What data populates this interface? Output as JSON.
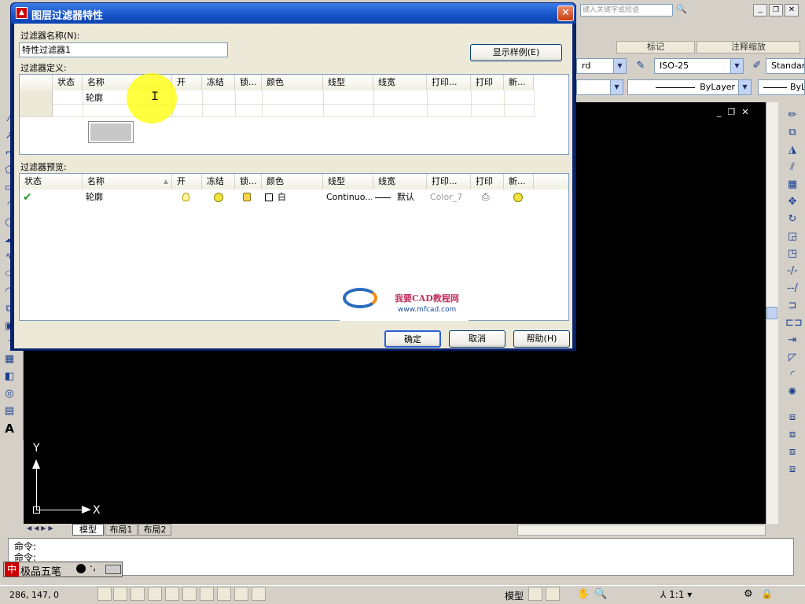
{
  "app": {
    "search_placeholder": "键入关键字或短语",
    "ribbon_tabs": [
      "标记",
      "注释缩放"
    ],
    "dimstyle_value": "ISO-25",
    "textstyle_value": "Standar",
    "leftcombo_value": "rd",
    "linetype_value": "ByLayer",
    "lineweight_value": "ByL",
    "layout_tabs": [
      "模型",
      "布局1",
      "布局2"
    ],
    "command_lines": [
      "命令:",
      "命令:"
    ],
    "ime_label": "极品五笔",
    "ime_char": "中",
    "coords": "286, 147, 0",
    "status_model_label": "模型",
    "annotation_scale": "1:1",
    "axis_x": "X",
    "axis_y": "Y"
  },
  "dialog": {
    "title": "图层过滤器特性",
    "filter_name_label": "过滤器名称(N):",
    "filter_name_value": "特性过滤器1",
    "show_example_button": "显示样例(E)",
    "definition_label": "过滤器定义:",
    "definition_columns": [
      "状态",
      "名称",
      "开",
      "冻结",
      "锁...",
      "颜色",
      "线型",
      "线宽",
      "打印...",
      "打印",
      "新..."
    ],
    "definition_row_name": "轮廓",
    "preview_label": "过滤器预览:",
    "preview_columns": [
      "状态",
      "名称",
      "开",
      "冻结",
      "锁...",
      "颜色",
      "线型",
      "线宽",
      "打印...",
      "打印",
      "新..."
    ],
    "preview_row": {
      "name": "轮廓",
      "color": "白",
      "linetype": "Continuo...",
      "lineweight": "默认",
      "plotstyle": "Color_7"
    },
    "ok_button": "确定",
    "cancel_button": "取消",
    "help_button": "帮助(H)"
  },
  "watermark": {
    "title": "我要CAD教程网",
    "url": "www.mfcad.com"
  },
  "colors": {
    "titlebar": "#1653c7",
    "cursor_highlight": "#ffff00",
    "check_green": "#2a9a2a"
  }
}
